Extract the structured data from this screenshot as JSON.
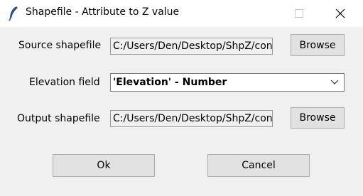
{
  "window": {
    "title": "Shapefile - Attribute to Z value",
    "icon": "feather-icon",
    "controls": [
      "minimize-icon",
      "maximize-icon",
      "close-icon"
    ]
  },
  "form": {
    "source": {
      "label": "Source shapefile",
      "value": "C:/Users/Den/Desktop/ShpZ/conto",
      "button": "Browse"
    },
    "elevation": {
      "label": "Elevation field",
      "selected": "'Elevation' - Number"
    },
    "output": {
      "label": "Output shapefile",
      "value": "C:/Users/Den/Desktop/ShpZ/conto",
      "button": "Browse"
    }
  },
  "actions": {
    "ok": "Ok",
    "cancel": "Cancel"
  }
}
